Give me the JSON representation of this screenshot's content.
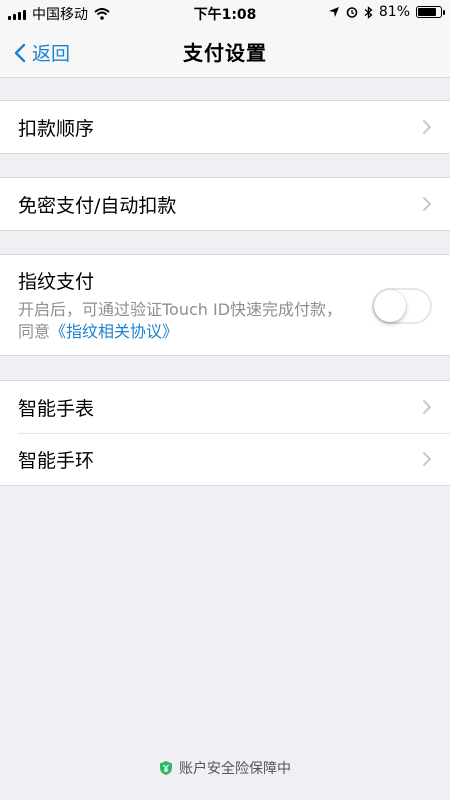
{
  "status_bar": {
    "carrier": "中国移动",
    "time": "下午1:08",
    "battery": "81%",
    "battery_level": 0.81
  },
  "nav": {
    "back_label": "返回",
    "title": "支付设置"
  },
  "groups": {
    "deduct_order": {
      "label": "扣款顺序"
    },
    "password_free": {
      "label": "免密支付/自动扣款"
    },
    "fingerprint": {
      "title": "指纹支付",
      "desc": "开启后，可通过验证Touch ID快速完成付款，同意",
      "link": "《指纹相关协议》",
      "enabled": false
    },
    "watch": {
      "label": "智能手表"
    },
    "band": {
      "label": "智能手环"
    }
  },
  "footer": {
    "text": "账户安全险保障中"
  },
  "colors": {
    "accent": "#1b82d2",
    "shield": "#2db76a"
  }
}
